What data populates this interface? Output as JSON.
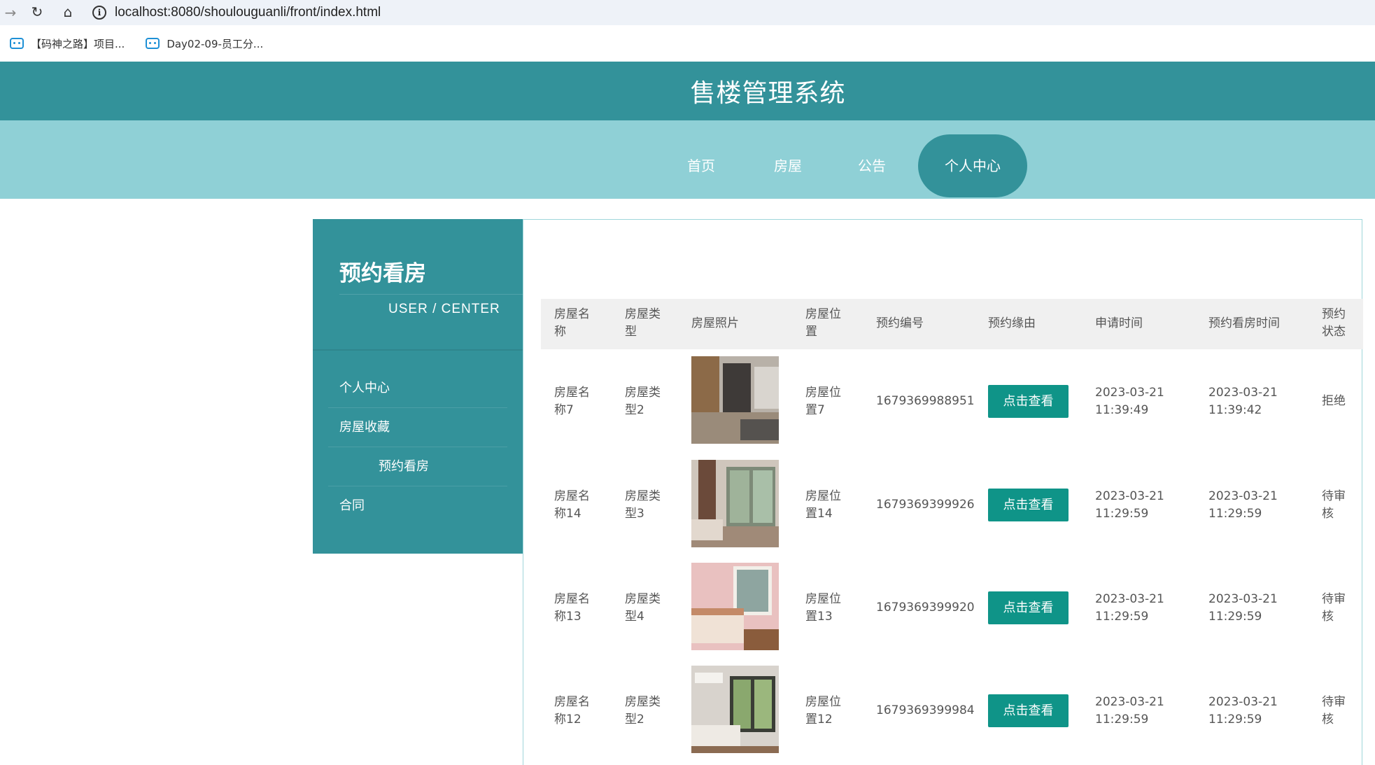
{
  "browser": {
    "url": "localhost:8080/shoulouguanli/front/index.html",
    "bookmarks": [
      "【码神之路】项目...",
      "Day02-09-员工分..."
    ]
  },
  "header": {
    "title": "售楼管理系统"
  },
  "nav": {
    "items": [
      "首页",
      "房屋",
      "公告",
      "个人中心"
    ],
    "active": "个人中心"
  },
  "sidebar": {
    "title": "预约看房",
    "subtitle": "USER / CENTER",
    "items": [
      "个人中心",
      "房屋收藏",
      "预约看房",
      "合同"
    ]
  },
  "table": {
    "headers": [
      "房屋名称",
      "房屋类型",
      "房屋照片",
      "房屋位置",
      "预约编号",
      "预约缘由",
      "申请时间",
      "预约看房时间",
      "预约状态"
    ],
    "button_label": "点击查看",
    "rows": [
      {
        "name": "房屋名称7",
        "type": "房屋类型2",
        "location": "房屋位置7",
        "code": "1679369988951",
        "apply_date": "2023-03-21",
        "apply_time": "11:39:49",
        "view_date": "2023-03-21",
        "view_time": "11:39:42",
        "status": "拒绝"
      },
      {
        "name": "房屋名称14",
        "type": "房屋类型3",
        "location": "房屋位置14",
        "code": "1679369399926",
        "apply_date": "2023-03-21",
        "apply_time": "11:29:59",
        "view_date": "2023-03-21",
        "view_time": "11:29:59",
        "status": "待审核"
      },
      {
        "name": "房屋名称13",
        "type": "房屋类型4",
        "location": "房屋位置13",
        "code": "1679369399920",
        "apply_date": "2023-03-21",
        "apply_time": "11:29:59",
        "view_date": "2023-03-21",
        "view_time": "11:29:59",
        "status": "待审核"
      },
      {
        "name": "房屋名称12",
        "type": "房屋类型2",
        "location": "房屋位置12",
        "code": "1679369399984",
        "apply_date": "2023-03-21",
        "apply_time": "11:29:59",
        "view_date": "2023-03-21",
        "view_time": "11:29:59",
        "status": "待审核"
      }
    ]
  }
}
